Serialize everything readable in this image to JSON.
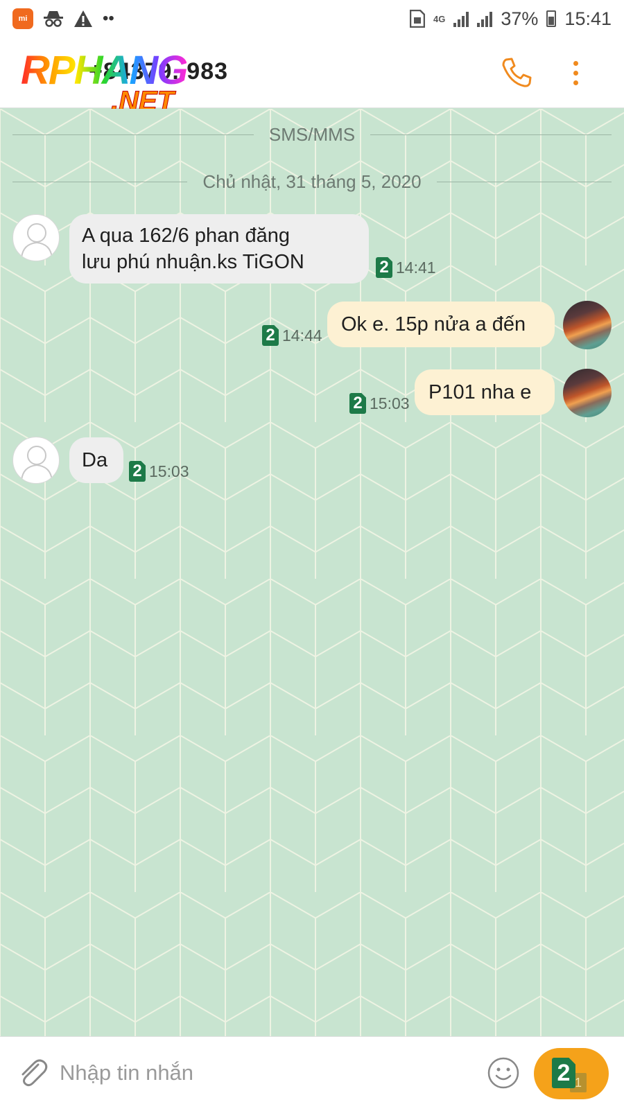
{
  "status_bar": {
    "network": "4G",
    "battery": "37%",
    "time": "15:41",
    "icons": [
      "mi-app-icon",
      "incognito-icon",
      "warning-icon",
      "more-dots-icon",
      "sim-card-icon",
      "signal-icon",
      "battery-icon"
    ]
  },
  "header": {
    "contact": "+84379..983",
    "watermark_main": "RPHANG",
    "watermark_sub": ".NET",
    "icons": [
      "phone-icon",
      "more-vertical-icon"
    ],
    "accent_color": "#f08a1e"
  },
  "chat": {
    "channel_label": "SMS/MMS",
    "date_label": "Chủ nhật, 31 tháng 5, 2020",
    "messages": [
      {
        "direction": "incoming",
        "lines": [
          "A qua 162/6 phan đăng",
          "lưu phú nhuận.ks TiGON"
        ],
        "sim": "2",
        "time": "14:41"
      },
      {
        "direction": "outgoing",
        "text": "Ok e. 15p nửa a đến",
        "sim": "2",
        "time": "14:44"
      },
      {
        "direction": "outgoing",
        "text": "P101 nha e",
        "sim": "2",
        "time": "15:03"
      },
      {
        "direction": "incoming",
        "text": "Da",
        "sim": "2",
        "time": "15:03"
      }
    ],
    "background_color": "#c8e4d0",
    "bubble_outgoing_color": "#fdf1d3",
    "bubble_incoming_color": "#eeeeee"
  },
  "composer": {
    "placeholder": "Nhập tin nhắn",
    "send_sim": "2",
    "send_sim_secondary": "1",
    "icons": [
      "paperclip-icon",
      "smiley-icon"
    ],
    "send_color": "#f5a21a"
  }
}
